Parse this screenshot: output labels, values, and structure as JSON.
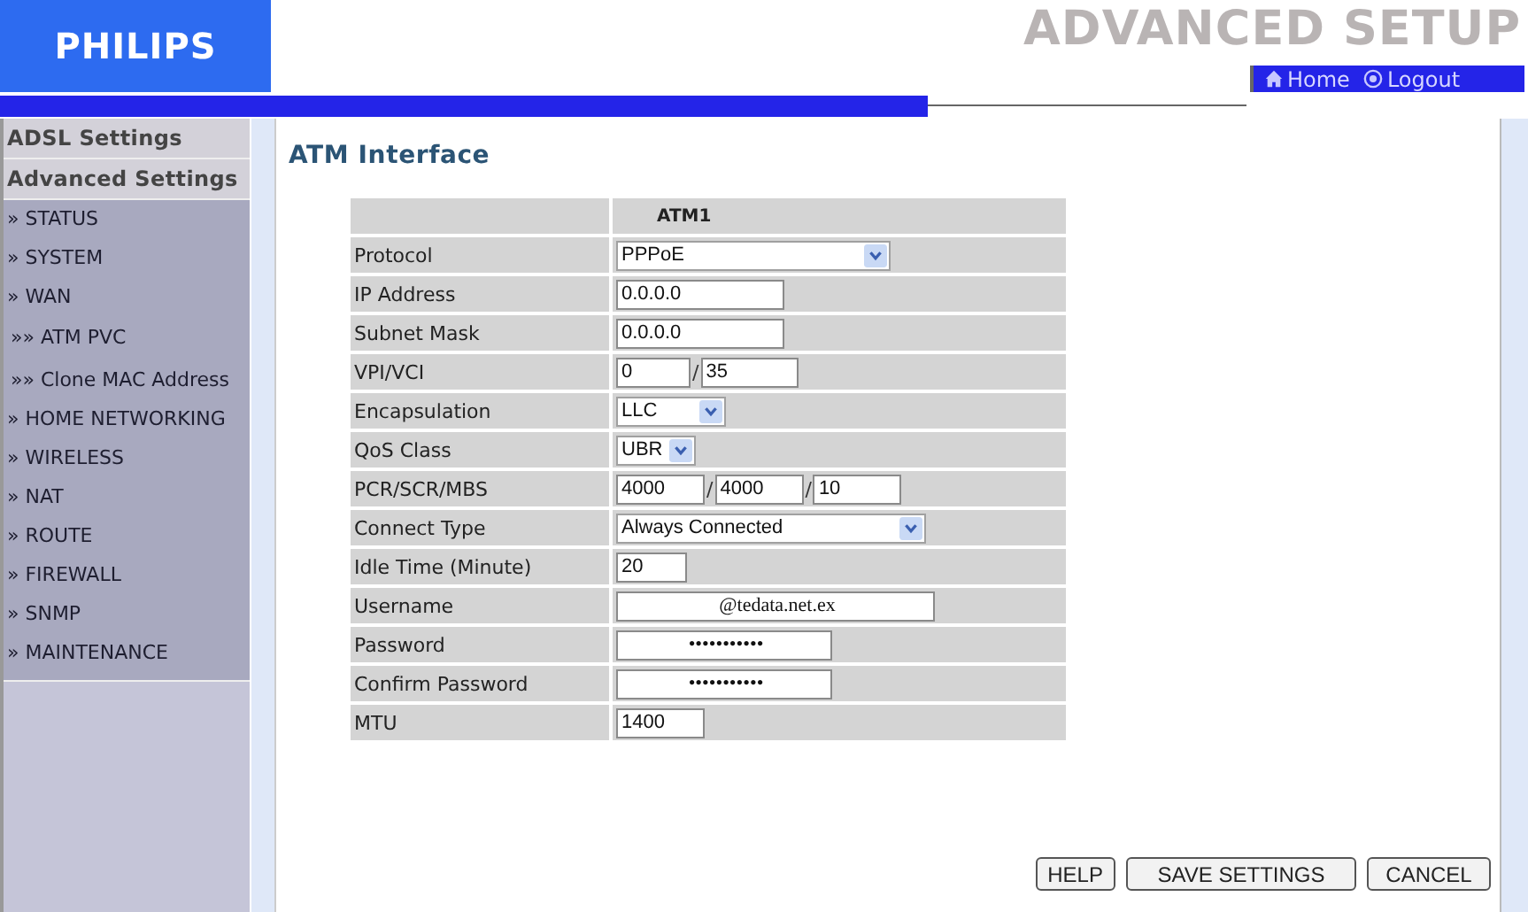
{
  "header": {
    "logo": "PHILIPS",
    "title": "ADVANCED SETUP",
    "nav": [
      {
        "label": "Home"
      },
      {
        "label": "Logout"
      }
    ]
  },
  "sidebar": {
    "sections": [
      {
        "label": "ADSL Settings"
      },
      {
        "label": "Advanced Settings"
      }
    ],
    "items": [
      {
        "label": "» STATUS"
      },
      {
        "label": "» SYSTEM"
      },
      {
        "label": "» WAN",
        "children": [
          {
            "label": "»» ATM PVC"
          },
          {
            "label": "»» Clone MAC Address"
          }
        ]
      },
      {
        "label": "» HOME NETWORKING"
      },
      {
        "label": "» WIRELESS"
      },
      {
        "label": "» NAT"
      },
      {
        "label": "» ROUTE"
      },
      {
        "label": "» FIREWALL"
      },
      {
        "label": "» SNMP"
      },
      {
        "label": "» MAINTENANCE"
      }
    ]
  },
  "page_title": "ATM Interface",
  "table": {
    "column_header": "ATM1",
    "rows": [
      {
        "label": "Protocol",
        "kind": "select",
        "values": [
          "PPPoE"
        ]
      },
      {
        "label": "IP Address",
        "kind": "text",
        "values": [
          "0.0.0.0"
        ]
      },
      {
        "label": "Subnet Mask",
        "kind": "text",
        "values": [
          "0.0.0.0"
        ]
      },
      {
        "label": "VPI/VCI",
        "kind": "text",
        "separator": "/",
        "values": [
          "0",
          "35"
        ]
      },
      {
        "label": "Encapsulation",
        "kind": "select",
        "values": [
          "LLC"
        ]
      },
      {
        "label": "QoS Class",
        "kind": "select",
        "values": [
          "UBR"
        ]
      },
      {
        "label": "PCR/SCR/MBS",
        "kind": "text",
        "separator": "/",
        "values": [
          "4000",
          "4000",
          "10"
        ]
      },
      {
        "label": "Connect Type",
        "kind": "select",
        "values": [
          "Always Connected"
        ]
      },
      {
        "label": "Idle Time (Minute)",
        "kind": "text",
        "values": [
          "20"
        ]
      },
      {
        "label": "Username",
        "kind": "masked",
        "values": [
          "@tedata.net.ex"
        ]
      },
      {
        "label": "Password",
        "kind": "masked",
        "values": [
          "•••••••••••"
        ]
      },
      {
        "label": "Confirm Password",
        "kind": "masked",
        "values": [
          "•••••••••••"
        ]
      },
      {
        "label": "MTU",
        "kind": "text",
        "values": [
          "1400"
        ]
      }
    ]
  },
  "buttons": [
    "HELP",
    "SAVE SETTINGS",
    "CANCEL"
  ]
}
